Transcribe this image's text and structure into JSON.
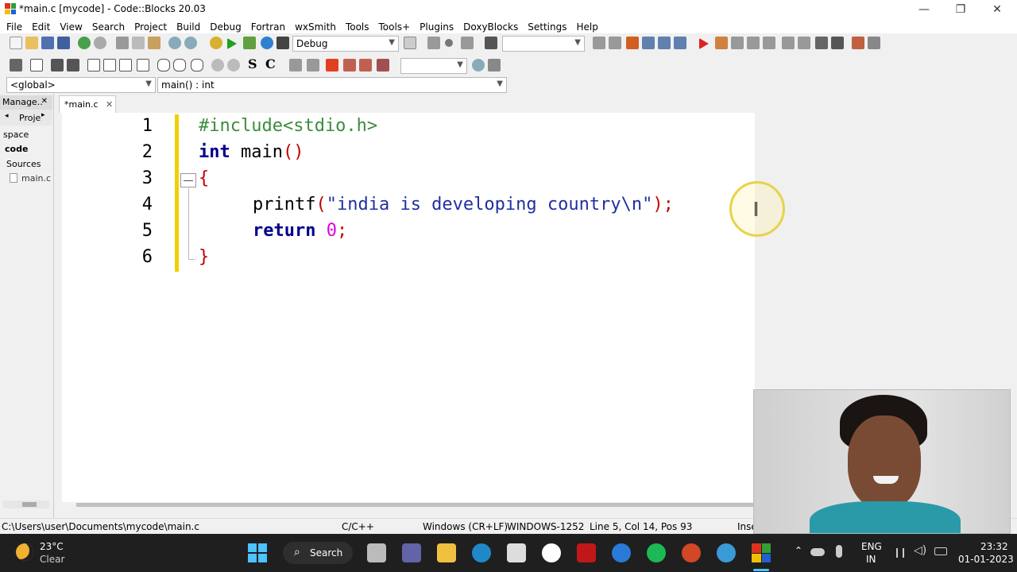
{
  "window": {
    "title": "*main.c [mycode] - Code::Blocks 20.03",
    "controls": [
      "—",
      "❐",
      "✕"
    ]
  },
  "menu": [
    "File",
    "Edit",
    "View",
    "Search",
    "Project",
    "Build",
    "Debug",
    "Fortran",
    "wxSmith",
    "Tools",
    "Tools+",
    "Plugins",
    "DoxyBlocks",
    "Settings",
    "Help"
  ],
  "toolbar": {
    "build_target": "Debug"
  },
  "scope": {
    "scope_value": "<global>",
    "function_value": "main() : int"
  },
  "management": {
    "tab_label": "Manage..",
    "close": "✕",
    "projects_tab": "Proje",
    "tree": [
      "space",
      "code",
      "Sources",
      "main.c"
    ]
  },
  "editor": {
    "tab_label": "*main.c",
    "tab_close": "✕",
    "line_numbers": [
      "1",
      "2",
      "3",
      "4",
      "5",
      "6"
    ],
    "lines": {
      "l1": "#include<stdio.h>",
      "l2_kw": "int",
      "l2_rest": " main",
      "l2_paren": "()",
      "l3": "{",
      "l4_fn": "printf",
      "l4_open": "(",
      "l4_str": "\"india is developing country\\n\"",
      "l4_close": ")",
      "l4_semi": ";",
      "l5_kw": "return",
      "l5_num": "0",
      "l5_semi": ";",
      "l6": "}"
    }
  },
  "status": {
    "path": "C:\\Users\\user\\Documents\\mycode\\main.c",
    "lang": "C/C++",
    "eol": "Windows (CR+LF)",
    "encoding": "WINDOWS-1252",
    "position": "Line 5, Col 14, Pos 93",
    "mode": "Inse"
  },
  "taskbar": {
    "weather_temp": "23°C",
    "weather_desc": "Clear",
    "search_label": "Search",
    "lang_top": "ENG",
    "lang_bottom": "IN",
    "time": "23:32",
    "date": "01-01-2023"
  },
  "colors": {
    "keyword": "#00008b",
    "preprocessor": "#3c8c3c",
    "string": "#2030a0",
    "number": "#e000e0",
    "brace": "#c00000",
    "change_bar": "#f0d000"
  }
}
